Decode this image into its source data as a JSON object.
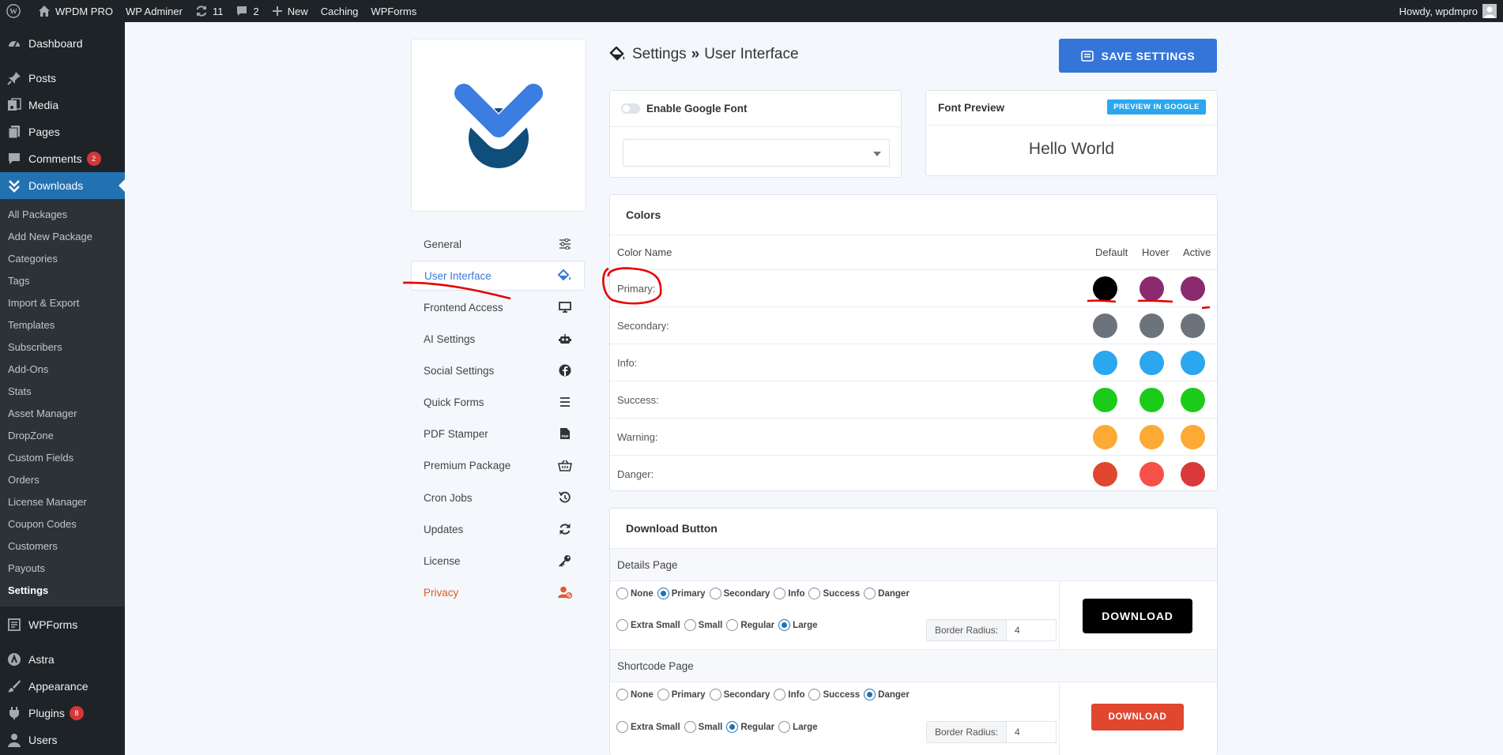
{
  "adminbar": {
    "site_name": "WPDM PRO",
    "adminer": "WP Adminer",
    "updates_count": "11",
    "comments_count": "2",
    "new_label": "New",
    "caching": "Caching",
    "wpforms": "WPForms",
    "howdy": "Howdy, wpdmpro"
  },
  "sidebar": {
    "dashboard": "Dashboard",
    "posts": "Posts",
    "media": "Media",
    "pages": "Pages",
    "comments": "Comments",
    "comments_badge": "2",
    "downloads": "Downloads",
    "submenu": [
      "All Packages",
      "Add New Package",
      "Categories",
      "Tags",
      "Import & Export",
      "Templates",
      "Subscribers",
      "Add-Ons",
      "Stats",
      "Asset Manager",
      "DropZone",
      "Custom Fields",
      "Orders",
      "License Manager",
      "Coupon Codes",
      "Customers",
      "Payouts",
      "Settings"
    ],
    "wpforms": "WPForms",
    "astra": "Astra",
    "appearance": "Appearance",
    "plugins": "Plugins",
    "plugins_badge": "8",
    "users": "Users"
  },
  "settings_nav": [
    "General",
    "User Interface",
    "Frontend Access",
    "AI Settings",
    "Social Settings",
    "Quick Forms",
    "PDF Stamper",
    "Premium Package",
    "Cron Jobs",
    "Updates",
    "License",
    "Privacy"
  ],
  "header": {
    "crumb_root": "Settings",
    "crumb_sep": "»",
    "crumb_page": "User Interface",
    "save_button": "SAVE SETTINGS"
  },
  "font": {
    "enable_label": "Enable Google Font",
    "preview_title": "Font Preview",
    "preview_button": "PREVIEW IN GOOGLE",
    "preview_text": "Hello World"
  },
  "colors": {
    "title": "Colors",
    "col_name": "Color Name",
    "col_default": "Default",
    "col_hover": "Hover",
    "col_active": "Active",
    "rows": [
      {
        "name": "Primary:",
        "default": "#000000",
        "hover": "#8b2a6e",
        "active": "#8b2a6e"
      },
      {
        "name": "Secondary:",
        "default": "#6c737c",
        "hover": "#6c737c",
        "active": "#6c737c"
      },
      {
        "name": "Info:",
        "default": "#2aa7ee",
        "hover": "#2aa7ee",
        "active": "#2aa7ee"
      },
      {
        "name": "Success:",
        "default": "#1ccb1a",
        "hover": "#1ccb1a",
        "active": "#1ccb1a"
      },
      {
        "name": "Warning:",
        "default": "#fcaa35",
        "hover": "#fcaa35",
        "active": "#fcaa35"
      },
      {
        "name": "Danger:",
        "default": "#e0472e",
        "hover": "#f65049",
        "active": "#d83a3a"
      }
    ]
  },
  "download_button": {
    "title": "Download Button",
    "styles": [
      "None",
      "Primary",
      "Secondary",
      "Info",
      "Success",
      "Danger"
    ],
    "sizes": [
      "Extra Small",
      "Small",
      "Regular",
      "Large"
    ],
    "border_radius_label": "Border Radius:",
    "details": {
      "title": "Details Page",
      "style": "Primary",
      "size": "Large",
      "radius": "4",
      "button": "DOWNLOAD"
    },
    "shortcode": {
      "title": "Shortcode Page",
      "style": "Danger",
      "size": "Regular",
      "radius": "4",
      "button": "DOWNLOAD"
    }
  }
}
